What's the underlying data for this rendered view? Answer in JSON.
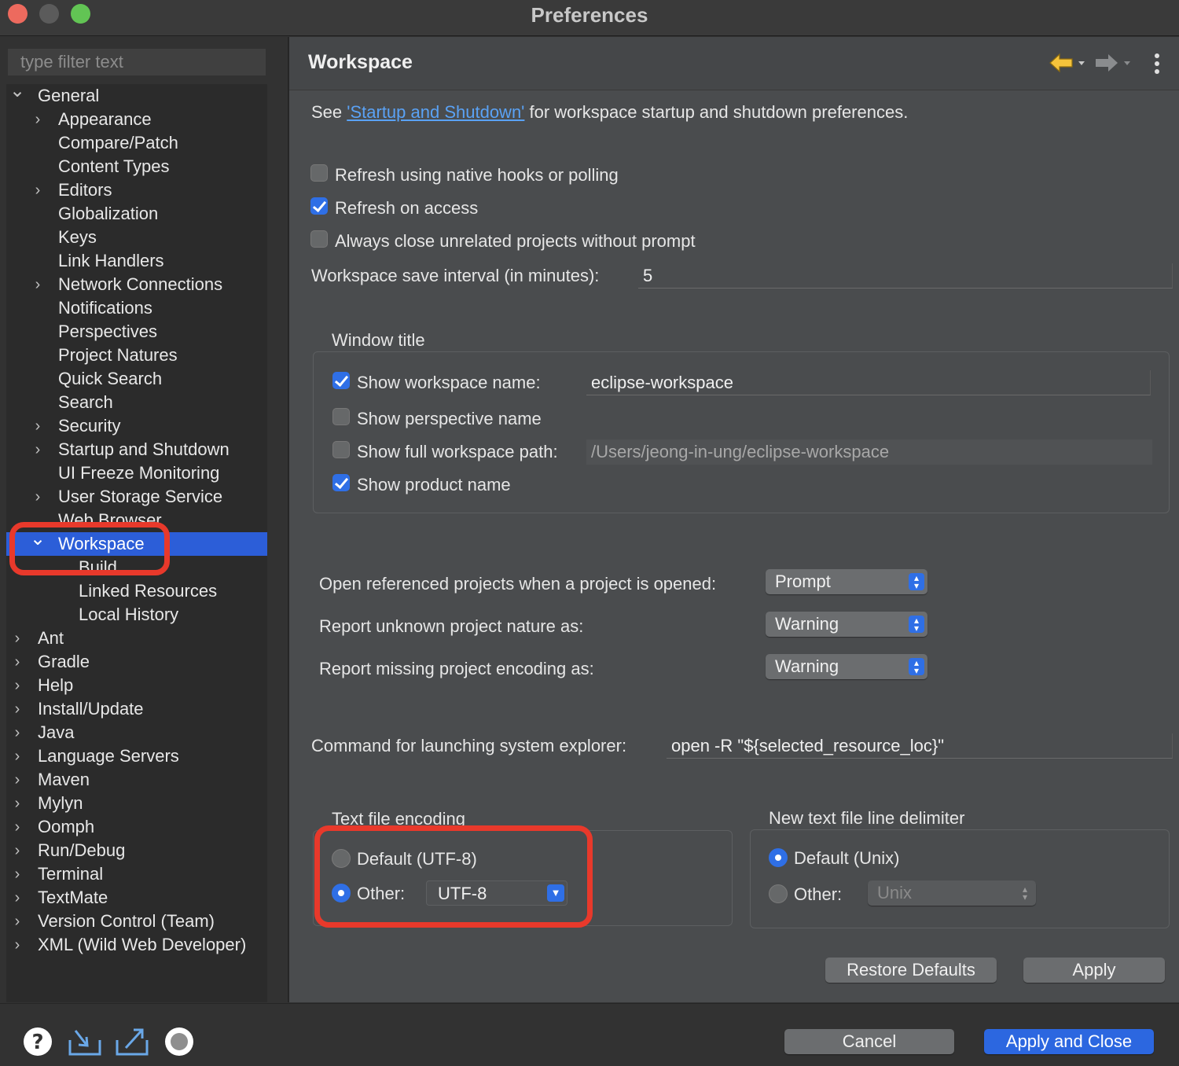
{
  "window": {
    "title": "Preferences"
  },
  "filter": {
    "placeholder": "type filter text"
  },
  "tree": {
    "items": [
      {
        "label": "General",
        "level": 0,
        "expander": "open"
      },
      {
        "label": "Appearance",
        "level": 1,
        "expander": "closed"
      },
      {
        "label": "Compare/Patch",
        "level": 1,
        "expander": "none"
      },
      {
        "label": "Content Types",
        "level": 1,
        "expander": "none"
      },
      {
        "label": "Editors",
        "level": 1,
        "expander": "closed"
      },
      {
        "label": "Globalization",
        "level": 1,
        "expander": "none"
      },
      {
        "label": "Keys",
        "level": 1,
        "expander": "none"
      },
      {
        "label": "Link Handlers",
        "level": 1,
        "expander": "none"
      },
      {
        "label": "Network Connections",
        "level": 1,
        "expander": "closed"
      },
      {
        "label": "Notifications",
        "level": 1,
        "expander": "none"
      },
      {
        "label": "Perspectives",
        "level": 1,
        "expander": "none"
      },
      {
        "label": "Project Natures",
        "level": 1,
        "expander": "none"
      },
      {
        "label": "Quick Search",
        "level": 1,
        "expander": "none"
      },
      {
        "label": "Search",
        "level": 1,
        "expander": "none"
      },
      {
        "label": "Security",
        "level": 1,
        "expander": "closed"
      },
      {
        "label": "Startup and Shutdown",
        "level": 1,
        "expander": "closed"
      },
      {
        "label": "UI Freeze Monitoring",
        "level": 1,
        "expander": "none"
      },
      {
        "label": "User Storage Service",
        "level": 1,
        "expander": "closed"
      },
      {
        "label": "Web Browser",
        "level": 1,
        "expander": "none"
      },
      {
        "label": "Workspace",
        "level": 1,
        "expander": "open",
        "selected": true
      },
      {
        "label": "Build",
        "level": 2,
        "expander": "none"
      },
      {
        "label": "Linked Resources",
        "level": 2,
        "expander": "none"
      },
      {
        "label": "Local History",
        "level": 2,
        "expander": "none"
      },
      {
        "label": "Ant",
        "level": 0,
        "expander": "closed"
      },
      {
        "label": "Gradle",
        "level": 0,
        "expander": "closed"
      },
      {
        "label": "Help",
        "level": 0,
        "expander": "closed"
      },
      {
        "label": "Install/Update",
        "level": 0,
        "expander": "closed"
      },
      {
        "label": "Java",
        "level": 0,
        "expander": "closed"
      },
      {
        "label": "Language Servers",
        "level": 0,
        "expander": "closed"
      },
      {
        "label": "Maven",
        "level": 0,
        "expander": "closed"
      },
      {
        "label": "Mylyn",
        "level": 0,
        "expander": "closed"
      },
      {
        "label": "Oomph",
        "level": 0,
        "expander": "closed"
      },
      {
        "label": "Run/Debug",
        "level": 0,
        "expander": "closed"
      },
      {
        "label": "Terminal",
        "level": 0,
        "expander": "closed"
      },
      {
        "label": "TextMate",
        "level": 0,
        "expander": "closed"
      },
      {
        "label": "Version Control (Team)",
        "level": 0,
        "expander": "closed"
      },
      {
        "label": "XML (Wild Web Developer)",
        "level": 0,
        "expander": "closed"
      }
    ]
  },
  "header": {
    "title": "Workspace",
    "back_icon": "back-arrow-icon",
    "forward_icon": "forward-arrow-icon",
    "menu_icon": "view-menu-icon"
  },
  "intro": {
    "prefix": "See ",
    "link": "'Startup and Shutdown'",
    "suffix": " for workspace startup and shutdown preferences."
  },
  "options": {
    "refresh_native": {
      "label": "Refresh using native hooks or polling",
      "checked": false
    },
    "refresh_access": {
      "label": "Refresh on access",
      "checked": true
    },
    "close_unrelated": {
      "label": "Always close unrelated projects without prompt",
      "checked": false
    }
  },
  "save_interval": {
    "label": "Workspace save interval (in minutes):",
    "value": "5"
  },
  "window_title": {
    "group_label": "Window title",
    "show_workspace_name": {
      "label": "Show workspace name:",
      "checked": true,
      "value": "eclipse-workspace"
    },
    "show_perspective_name": {
      "label": "Show perspective name",
      "checked": false
    },
    "show_full_path": {
      "label": "Show full workspace path:",
      "checked": false,
      "value": "/Users/jeong-in-ung/eclipse-workspace"
    },
    "show_product_name": {
      "label": "Show product name",
      "checked": true
    }
  },
  "projects": {
    "open_referenced": {
      "label": "Open referenced projects when a project is opened:",
      "value": "Prompt"
    },
    "unknown_nature": {
      "label": "Report unknown project nature as:",
      "value": "Warning"
    },
    "missing_encoding": {
      "label": "Report missing project encoding as:",
      "value": "Warning"
    }
  },
  "explorer": {
    "label": "Command for launching system explorer:",
    "value": "open -R \"${selected_resource_loc}\""
  },
  "encoding": {
    "group_label": "Text file encoding",
    "default_label": "Default (UTF-8)",
    "other_label": "Other:",
    "other_value": "UTF-8",
    "selected": "other"
  },
  "delimiter": {
    "group_label": "New text file line delimiter",
    "default_label": "Default (Unix)",
    "other_label": "Other:",
    "other_value": "Unix",
    "selected": "default"
  },
  "buttons": {
    "restore_defaults": "Restore Defaults",
    "apply": "Apply",
    "cancel": "Cancel",
    "apply_and_close": "Apply and Close"
  },
  "bottom_icons": [
    "help-icon",
    "import-icon",
    "export-icon",
    "oomph-record-icon"
  ],
  "colors": {
    "accent": "#2c67e0",
    "selection": "#2c5ed8",
    "highlight_annotation": "#e8392b"
  }
}
